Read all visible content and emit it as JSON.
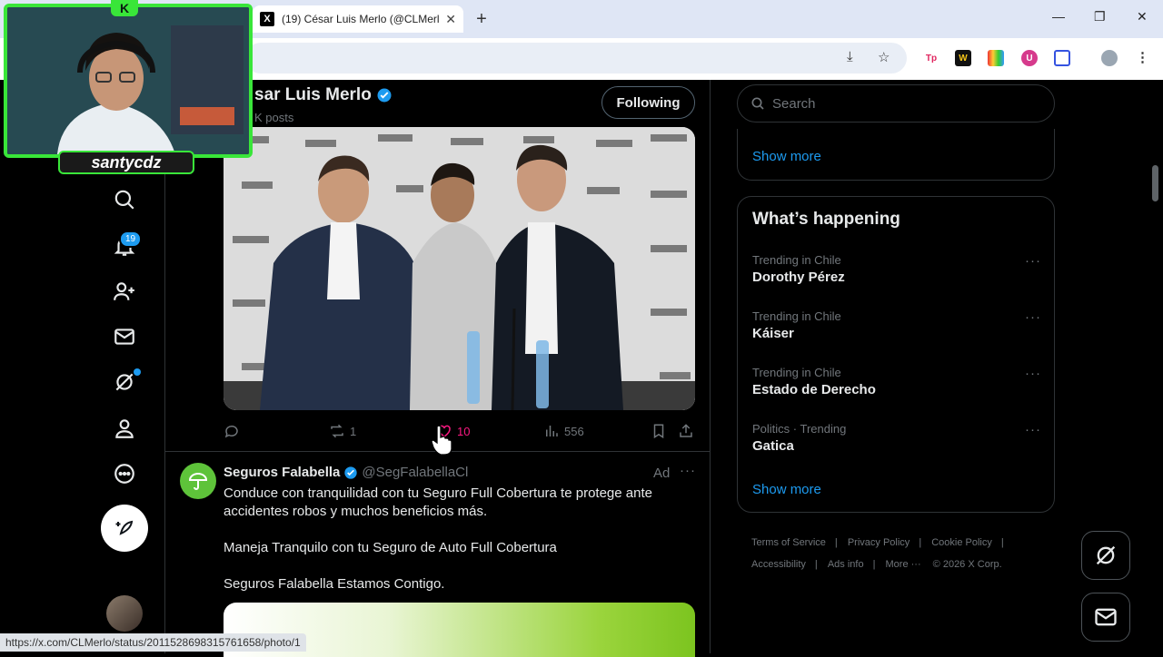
{
  "browser": {
    "tab_title": "(19) César Luis Merlo (@CLMerl...",
    "tab_favicon": "X",
    "new_tab_symbol": "+",
    "status_url": "https://x.com/CLMerlo/status/2011528698315761658/photo/1",
    "ext_tp": "Tp",
    "ext_w": "W",
    "ext_u": "U"
  },
  "profile": {
    "name": "sar Luis Merlo",
    "posts": "K posts",
    "following_label": "Following"
  },
  "nav": {
    "notifications_badge": "19"
  },
  "tweet": {
    "retweets": "1",
    "likes": "10",
    "views": "556"
  },
  "ad": {
    "name": "Seguros Falabella",
    "handle": "@SegFalabellaCl",
    "label": "Ad",
    "more": "···",
    "paragraphs": [
      "Conduce con tranquilidad con tu Seguro Full Cobertura te protege ante accidentes robos y muchos beneficios más.",
      "Maneja Tranquilo con tu Seguro de Auto Full Cobertura",
      "Seguros Falabella Estamos Contigo."
    ]
  },
  "sidebar": {
    "search_placeholder": "Search",
    "show_more_top": "Show more",
    "whats_happening": "What’s happening",
    "trends": [
      {
        "context": "Trending in Chile",
        "name": "Dorothy Pérez"
      },
      {
        "context": "Trending in Chile",
        "name": "Káiser"
      },
      {
        "context": "Trending in Chile",
        "name": "Estado de Derecho"
      },
      {
        "context": "Politics · Trending",
        "name": "Gatica"
      }
    ],
    "trend_more": "···",
    "show_more_bottom": "Show more",
    "footer": {
      "terms": "Terms of Service",
      "privacy": "Privacy Policy",
      "cookie": "Cookie Policy",
      "accessibility": "Accessibility",
      "ads_info": "Ads info",
      "more": "More ···",
      "copyright": "© 2026 X Corp."
    }
  },
  "stream": {
    "name": "santycdz",
    "logo_letter": "K"
  },
  "colors": {
    "accent": "#1d9bf0",
    "like": "#f91880",
    "stream_green": "#39e639"
  }
}
